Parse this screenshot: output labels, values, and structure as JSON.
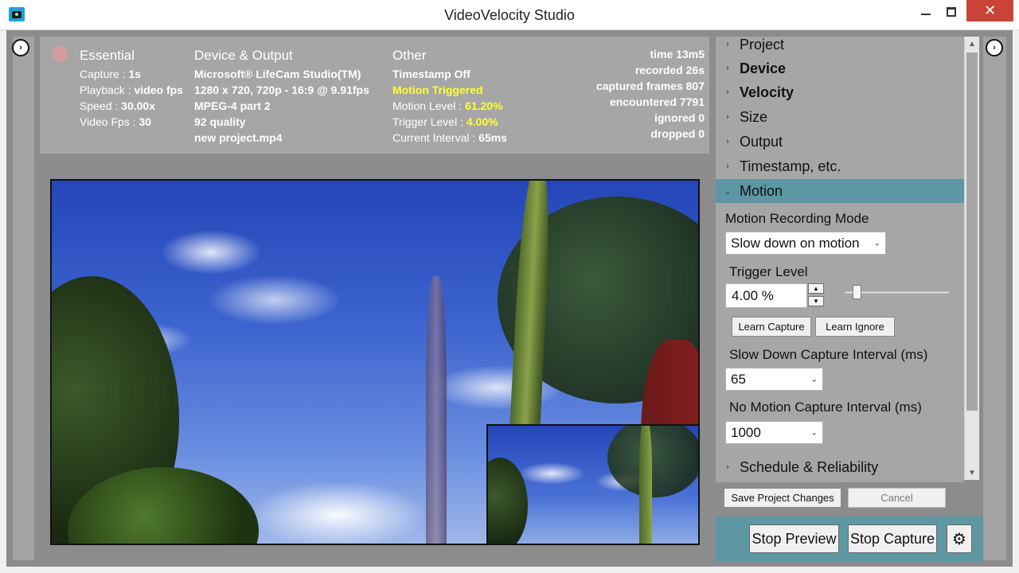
{
  "window": {
    "title": "VideoVelocity Studio",
    "app_icon": "camera-icon",
    "min_icon": "minimize-icon",
    "max_icon": "maximize-icon",
    "close_glyph": "✕"
  },
  "nav": {
    "left_glyph": "›",
    "right_glyph": "›"
  },
  "info": {
    "essential": {
      "heading": "Essential",
      "capture_label": "Capture : ",
      "capture_value": "1s",
      "playback_label": "Playback : ",
      "playback_value": "video fps",
      "speed_label": "Speed : ",
      "speed_value": "30.00x",
      "videofps_label": "Video Fps : ",
      "videofps_value": "30"
    },
    "device": {
      "heading": "Device & Output",
      "camera": "Microsoft® LifeCam Studio(TM)",
      "resolution": "1280 x 720, 720p - 16:9 @ 9.91fps",
      "codec": "MPEG-4 part 2",
      "quality": "92 quality",
      "file": "new project.mp4"
    },
    "other": {
      "heading": "Other",
      "timestamp": "Timestamp Off",
      "motion_state": "Motion Triggered",
      "motion_level_label": "Motion Level : ",
      "motion_level_value": "61.20%",
      "trigger_level_label": "Trigger Level : ",
      "trigger_level_value": "4.00%",
      "interval_label": "Current Interval : ",
      "interval_value": "65ms"
    },
    "stats": {
      "time": "time 13m5",
      "recorded": "recorded 26s",
      "captured": "captured frames 807",
      "encountered": "encountered 7791",
      "ignored": "ignored 0",
      "dropped": "dropped 0"
    }
  },
  "sections": {
    "project": "Project",
    "device": "Device",
    "velocity": "Velocity",
    "size": "Size",
    "output": "Output",
    "timestamp": "Timestamp, etc.",
    "motion": "Motion",
    "schedule": "Schedule & Reliability"
  },
  "motion": {
    "mode_label": "Motion Recording Mode",
    "mode_value": "Slow down on motion",
    "trigger_label": "Trigger Level",
    "trigger_value": "4.00 %",
    "trigger_slider_fraction": 0.08,
    "learn_capture": "Learn Capture",
    "learn_ignore": "Learn Ignore",
    "slow_label": "Slow Down Capture Interval (ms)",
    "slow_value": "65",
    "nomotion_label": "No Motion Capture Interval (ms)",
    "nomotion_value": "1000"
  },
  "actions": {
    "save": "Save Project Changes",
    "cancel": "Cancel",
    "stop_preview": "Stop Preview",
    "stop_capture": "Stop Capture",
    "settings_glyph": "⚙"
  },
  "colors": {
    "accent": "#5d97a3",
    "highlight": "#ffff33",
    "close": "#c94437"
  }
}
